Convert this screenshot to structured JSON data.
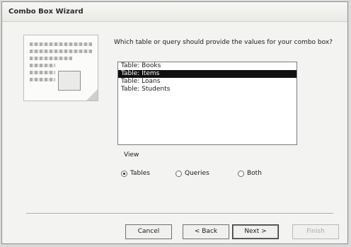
{
  "window": {
    "title": "Combo Box Wizard"
  },
  "prompt": {
    "question": "Which table or query should provide the values for your combo box?"
  },
  "list": {
    "items": [
      "Table: Books",
      "Table: Items",
      "Table: Loans",
      "Table: Students"
    ],
    "selected_index": 1
  },
  "view": {
    "label": "View",
    "options": [
      "Tables",
      "Queries",
      "Both"
    ],
    "selected": "Tables"
  },
  "buttons": {
    "cancel": "Cancel",
    "back": "< Back",
    "next": "Next >",
    "finish": "Finish"
  }
}
